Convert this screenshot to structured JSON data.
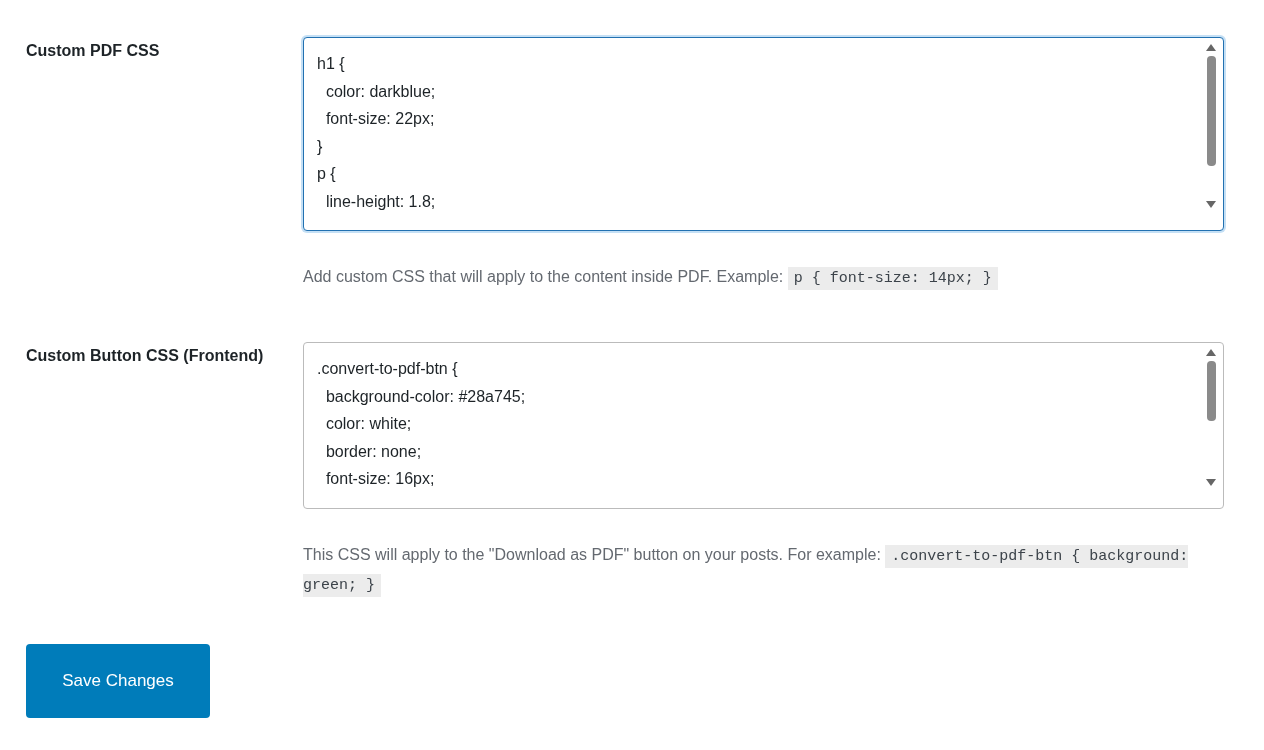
{
  "settings": [
    {
      "label": "Custom PDF CSS",
      "focused": true,
      "value": "h1 {\n  color: darkblue;\n  font-size: 22px;\n}\np {\n  line-height: 1.8;",
      "description": {
        "text": "Add custom CSS that will apply to the content inside PDF. Example:",
        "code": "p { font-size: 14px; }"
      }
    },
    {
      "label": "Custom Button CSS (Frontend)",
      "focused": false,
      "value": ".convert-to-pdf-btn {\n  background-color: #28a745;\n  color: white;\n  border: none;\n  font-size: 16px;",
      "description": {
        "text": "This CSS will apply to the \"Download as PDF\" button on your posts. For example:",
        "code": ".convert-to-pdf-btn { background: green; }"
      }
    }
  ],
  "save_button": "Save Changes"
}
